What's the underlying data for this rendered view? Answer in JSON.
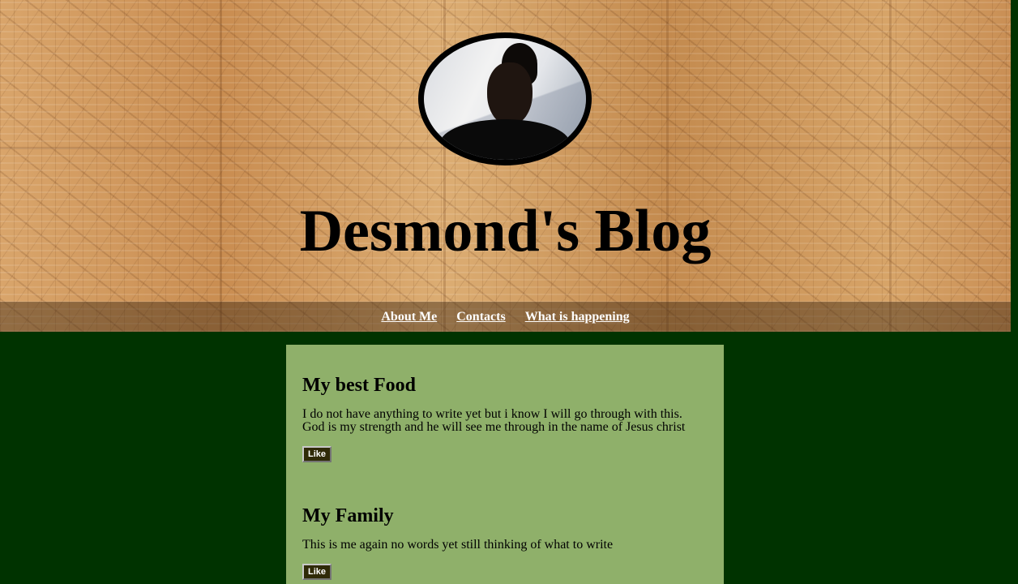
{
  "header": {
    "avatar_alt": "Blog author photo",
    "title": "Desmond's Blog"
  },
  "nav": {
    "items": [
      {
        "label": "About Me"
      },
      {
        "label": "Contacts"
      },
      {
        "label": "What is happening"
      }
    ]
  },
  "posts": [
    {
      "title": "My best Food",
      "body": "I do not have anything to write yet but i know I will go through with this. God is my strength and he will see me through in the name of Jesus christ",
      "like_label": "Like"
    },
    {
      "title": "My Family",
      "body": "This is me again no words yet still thinking of what to write",
      "like_label": "Like"
    }
  ],
  "colors": {
    "page_background": "#003300",
    "content_background": "#8fb06a",
    "like_button": "#2f2a08"
  }
}
